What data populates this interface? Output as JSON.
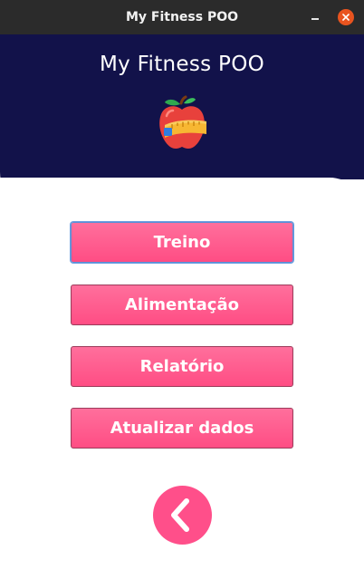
{
  "window": {
    "title": "My Fitness POO"
  },
  "header": {
    "app_title": "My Fitness POO",
    "logo_icon": "apple-measuring-tape-icon"
  },
  "menu": {
    "items": [
      {
        "label": "Treino",
        "focused": true
      },
      {
        "label": "Alimentação",
        "focused": false
      },
      {
        "label": "Relatório",
        "focused": false
      },
      {
        "label": "Atualizar dados",
        "focused": false
      }
    ]
  },
  "back": {
    "icon": "chevron-left-icon"
  },
  "colors": {
    "header_bg": "#12124a",
    "button_pink": "#ff5a8e",
    "close_orange": "#e9541f",
    "titlebar": "#2b2b2b"
  }
}
